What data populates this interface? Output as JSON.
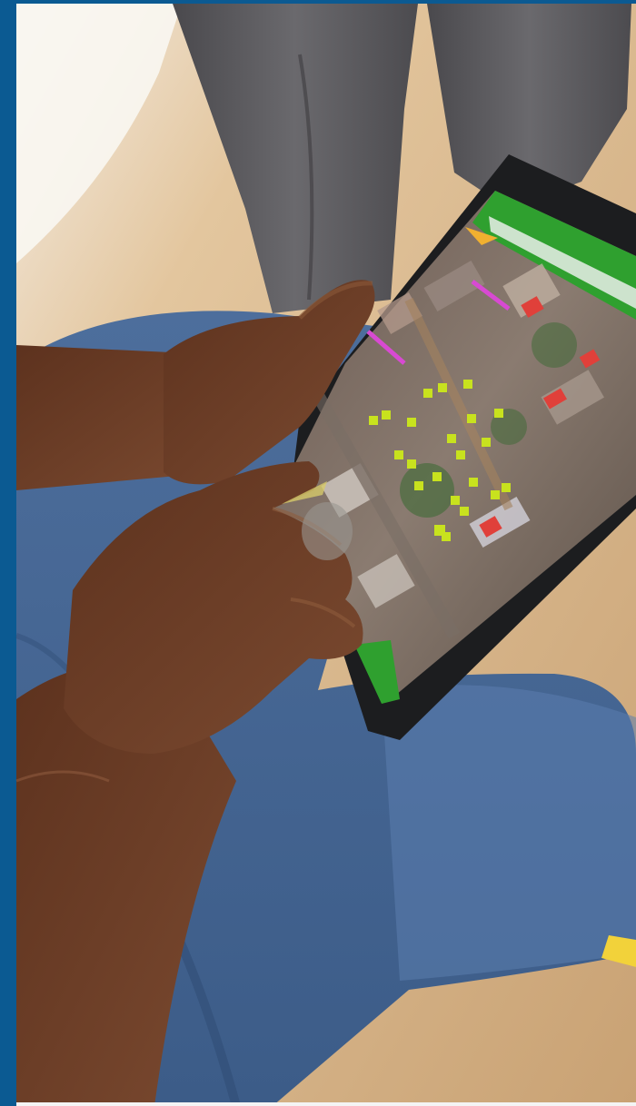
{
  "photo": {
    "description_icon": "photo-icon",
    "colors": {
      "frame_blue": "#0b5a92",
      "ground_sand": "#d9b88c",
      "jeans_blue": "#4a6a96",
      "skin_brown": "#6a3a22",
      "trousers_gray": "#57565a",
      "tablet_black": "#1c1d1f",
      "app_bar_green": "#2fa02f",
      "marker_yellow": "#c8e21e",
      "marker_red": "#e0403a"
    }
  },
  "tablet_app": {
    "map_markers_visible": 22,
    "header_text": "",
    "footer_text": ""
  }
}
